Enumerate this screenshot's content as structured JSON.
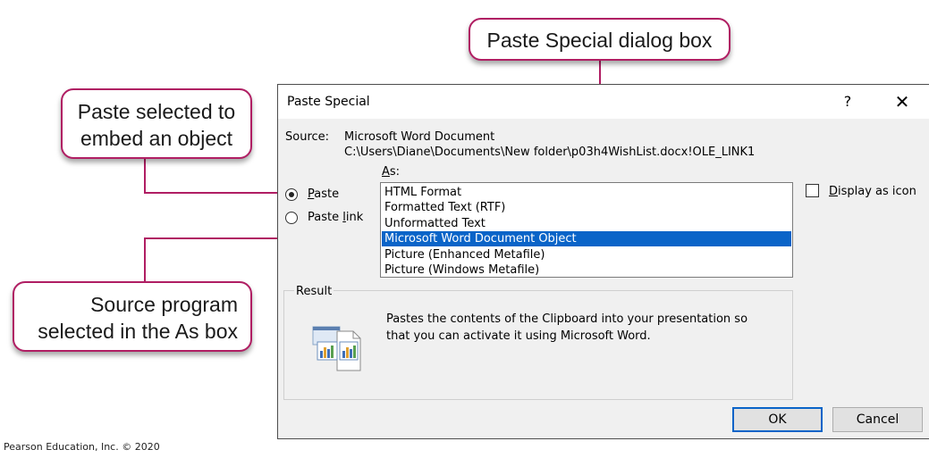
{
  "callouts": {
    "title": "Paste Special dialog box",
    "embed_line1": "Paste selected to",
    "embed_line2": "embed an object",
    "source_line1": "Source program",
    "source_line2": "selected in the As box"
  },
  "dialog": {
    "title": "Paste Special",
    "help": "?",
    "close": "✕",
    "source_label": "Source:",
    "source_name": "Microsoft Word Document",
    "source_path": "C:\\Users\\Diane\\Documents\\New folder\\p03h4WishList.docx!OLE_LINK1",
    "as_label_accel": "A",
    "as_label_rest": "s:",
    "paste_accel": "P",
    "paste_rest": "aste",
    "paste_link_pre": "Paste ",
    "paste_link_accel": "l",
    "paste_link_post": "ink",
    "paste_selected": true,
    "as_items": [
      "HTML Format",
      "Formatted Text (RTF)",
      "Unformatted Text",
      "Microsoft Word Document Object",
      "Picture (Enhanced Metafile)",
      "Picture (Windows Metafile)"
    ],
    "as_selected_index": 3,
    "display_icon_accel": "D",
    "display_icon_rest": "isplay as icon",
    "display_icon_checked": false,
    "result_label": "Result",
    "result_line1": "Pastes the contents of the Clipboard into your presentation so",
    "result_line2": "that you can activate it using Microsoft Word.",
    "ok": "OK",
    "cancel": "Cancel"
  },
  "copyright": "Pearson Education, Inc. © 2020",
  "colors": {
    "callout_border": "#b01e63",
    "selection": "#0a64c8",
    "dialog_bg": "#f0f0f0"
  }
}
